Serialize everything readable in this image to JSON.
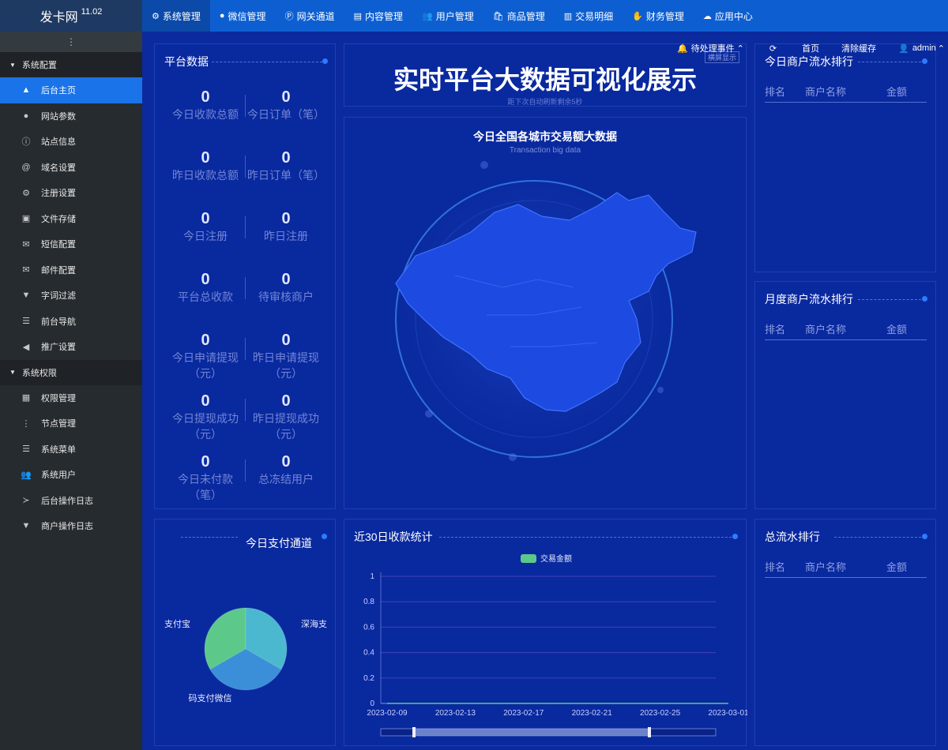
{
  "brand": {
    "name": "发卡网",
    "version": "11.02"
  },
  "topnav": [
    {
      "icon": "⚙",
      "label": "系统管理",
      "active": true
    },
    {
      "icon": "●",
      "label": "微信管理"
    },
    {
      "icon": "Ⓟ",
      "label": "网关通道"
    },
    {
      "icon": "▤",
      "label": "内容管理"
    },
    {
      "icon": "👥",
      "label": "用户管理"
    },
    {
      "icon": "🛍",
      "label": "商品管理"
    },
    {
      "icon": "▥",
      "label": "交易明细"
    },
    {
      "icon": "✋",
      "label": "财务管理"
    },
    {
      "icon": "☁",
      "label": "应用中心"
    }
  ],
  "toolbar": {
    "pending": "待处理事件",
    "home": "首页",
    "clear_cache": "清除缓存",
    "user": "admin"
  },
  "sidebar": {
    "toggle": "⋮",
    "groups": [
      {
        "label": "系统配置",
        "items": [
          {
            "icon": "▲",
            "label": "后台主页",
            "active": true
          },
          {
            "icon": "●",
            "label": "网站参数"
          },
          {
            "icon": "ⓘ",
            "label": "站点信息"
          },
          {
            "icon": "@",
            "label": "域名设置"
          },
          {
            "icon": "⚙",
            "label": "注册设置"
          },
          {
            "icon": "▣",
            "label": "文件存储"
          },
          {
            "icon": "✉",
            "label": "短信配置"
          },
          {
            "icon": "✉",
            "label": "邮件配置"
          },
          {
            "icon": "▼",
            "label": "字词过滤"
          },
          {
            "icon": "☰",
            "label": "前台导航"
          },
          {
            "icon": "◀",
            "label": "推广设置"
          }
        ]
      },
      {
        "label": "系统权限",
        "items": [
          {
            "icon": "▦",
            "label": "权限管理"
          },
          {
            "icon": "⋮",
            "label": "节点管理"
          },
          {
            "icon": "☰",
            "label": "系统菜单"
          },
          {
            "icon": "👥",
            "label": "系统用户"
          },
          {
            "icon": "≻",
            "label": "后台操作日志"
          },
          {
            "icon": "▼",
            "label": "商户操作日志"
          }
        ]
      }
    ]
  },
  "platform": {
    "title": "平台数据",
    "stats": [
      {
        "value": "0",
        "label": "今日收款总额"
      },
      {
        "value": "0",
        "label": "今日订单（笔）"
      },
      {
        "value": "0",
        "label": "昨日收款总额"
      },
      {
        "value": "0",
        "label": "昨日订单（笔）"
      },
      {
        "value": "0",
        "label": "今日注册"
      },
      {
        "value": "0",
        "label": "昨日注册"
      },
      {
        "value": "0",
        "label": "平台总收款"
      },
      {
        "value": "0",
        "label": "待审核商户"
      },
      {
        "value": "0",
        "label": "今日申请提现（元）"
      },
      {
        "value": "0",
        "label": "昨日申请提现（元）"
      },
      {
        "value": "0",
        "label": "今日提现成功（元）"
      },
      {
        "value": "0",
        "label": "昨日提现成功（元）"
      },
      {
        "value": "0",
        "label": "今日未付款（笔）"
      },
      {
        "value": "0",
        "label": "总冻结用户"
      }
    ]
  },
  "banner": {
    "title": "实时平台大数据可视化展示",
    "subtitle": "距下次自动刷新剩余5秒",
    "mode_button": "横屏显示"
  },
  "map": {
    "title": "今日全国各城市交易额大数据",
    "subtitle": "Transaction big data"
  },
  "rankings": {
    "today": {
      "title": "今日商户流水排行"
    },
    "month": {
      "title": "月度商户流水排行"
    },
    "total": {
      "title": "总流水排行"
    },
    "headers": {
      "rank": "排名",
      "name": "商户名称",
      "amount": "金额"
    }
  },
  "channels": {
    "title": "今日支付通道",
    "chart_data": {
      "type": "pie",
      "slices": [
        {
          "label": "支付宝",
          "value": 1,
          "color": "#5cc98a"
        },
        {
          "label": "深海支",
          "value": 1,
          "color": "#4cb8cf"
        },
        {
          "label": "码支付微信",
          "value": 1,
          "color": "#3a8fd8"
        }
      ]
    }
  },
  "receipts": {
    "title": "近30日收款统计",
    "chart_data": {
      "type": "line",
      "legend": [
        {
          "name": "交易金额",
          "color": "#5cc98a"
        }
      ],
      "x": [
        "2023-02-09",
        "2023-02-13",
        "2023-02-17",
        "2023-02-21",
        "2023-02-25",
        "2023-03-01"
      ],
      "yticks": [
        "0",
        "0.2",
        "0.4",
        "0.6",
        "0.8",
        "1"
      ],
      "ylim": [
        0,
        1
      ],
      "series": [
        {
          "name": "交易金额",
          "values": [
            0,
            0,
            0,
            0,
            0,
            0
          ]
        }
      ],
      "grid": true,
      "legend_position": "top-center"
    }
  }
}
